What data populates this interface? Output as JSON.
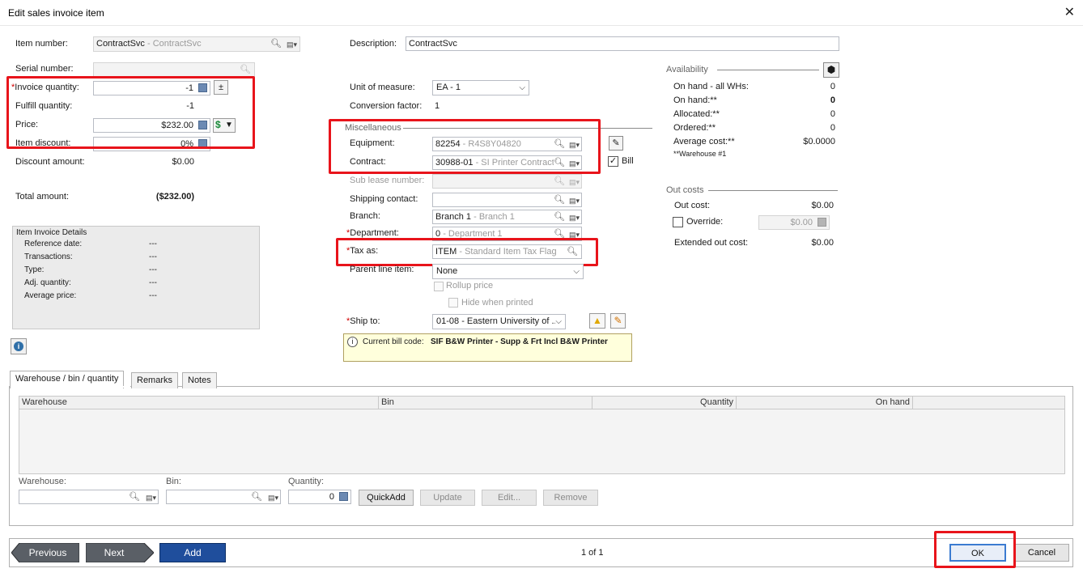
{
  "window": {
    "title": "Edit sales invoice item",
    "close": "✕"
  },
  "item": {
    "item_number_label": "Item number:",
    "item_number_code": "ContractSvc",
    "item_number_desc": "- ContractSvc",
    "serial_label": "Serial number:",
    "invoice_qty_label": "Invoice quantity:",
    "invoice_qty_value": "-1",
    "fulfill_qty_label": "Fulfill quantity:",
    "fulfill_qty_value": "-1",
    "price_label": "Price:",
    "price_value": "$232.00",
    "item_discount_label": "Item discount:",
    "item_discount_value": "0%",
    "discount_amount_label": "Discount amount:",
    "discount_amount_value": "$0.00",
    "total_amount_label": "Total amount:",
    "total_amount_value": "($232.00)",
    "required_mark": "*"
  },
  "invoice_details": {
    "title": "Item Invoice Details",
    "rows": [
      {
        "label": "Reference date:",
        "value": "---"
      },
      {
        "label": "Transactions:",
        "value": "---"
      },
      {
        "label": "Type:",
        "value": "---"
      },
      {
        "label": "Adj. quantity:",
        "value": "---"
      },
      {
        "label": "Average price:",
        "value": "---"
      }
    ]
  },
  "description": {
    "label": "Description:",
    "value": "ContractSvc"
  },
  "uom": {
    "label": "Unit of measure:",
    "value": "EA - 1",
    "conv_label": "Conversion factor:",
    "conv_value": "1"
  },
  "misc": {
    "title": "Miscellaneous",
    "equipment_label": "Equipment:",
    "equipment_code": "82254",
    "equipment_desc": "- R4S8Y04820",
    "contract_label": "Contract:",
    "contract_code": "30988-01",
    "contract_desc": "- SI Printer Contract",
    "bill_label": "Bill",
    "sublease_label": "Sub lease number:",
    "shipping_contact_label": "Shipping contact:",
    "branch_label": "Branch:",
    "branch_code": "Branch 1",
    "branch_desc": "- Branch 1",
    "department_label": "Department:",
    "department_code": "0",
    "department_desc": "- Department 1",
    "tax_label": "Tax as:",
    "tax_code": "ITEM",
    "tax_desc": "- Standard Item Tax Flag",
    "parent_line_label": "Parent line item:",
    "parent_line_value": "None",
    "rollup_label": "Rollup price",
    "hide_label": "Hide when printed",
    "ship_to_label": "Ship to:",
    "ship_to_value": "01-08 - Eastern University of ...",
    "bill_code_label": "Current bill code:",
    "bill_code_value": "SIF B&W Printer - Supp & Frt Incl B&W Printer"
  },
  "availability": {
    "title": "Availability",
    "rows": [
      {
        "label": "On hand - all WHs:",
        "value": "0",
        "bold": false
      },
      {
        "label": "On hand:**",
        "value": "0",
        "bold": true
      },
      {
        "label": "Allocated:**",
        "value": "0",
        "bold": false
      },
      {
        "label": "Ordered:**",
        "value": "0",
        "bold": false
      },
      {
        "label": "Average cost:**",
        "value": "$0.0000",
        "bold": false
      }
    ],
    "footnote": "**Warehouse #1"
  },
  "out_costs": {
    "title": "Out costs",
    "out_cost_label": "Out cost:",
    "out_cost_value": "$0.00",
    "override_label": "Override:",
    "override_value": "$0.00",
    "extended_label": "Extended out cost:",
    "extended_value": "$0.00"
  },
  "tabs": [
    {
      "label": "Warehouse / bin / quantity"
    },
    {
      "label": "Remarks"
    },
    {
      "label": "Notes"
    }
  ],
  "grid": {
    "columns": [
      "Warehouse",
      "Bin",
      "Quantity",
      "On hand"
    ]
  },
  "quickadd": {
    "warehouse_label": "Warehouse:",
    "bin_label": "Bin:",
    "quantity_label": "Quantity:",
    "quantity_value": "0",
    "quickadd_btn": "QuickAdd",
    "update_btn": "Update",
    "edit_btn": "Edit...",
    "remove_btn": "Remove"
  },
  "footer": {
    "previous": "Previous",
    "next": "Next",
    "add": "Add",
    "paging": "1 of 1",
    "ok": "OK",
    "cancel": "Cancel"
  },
  "colors": {
    "highlight_red": "#e8141b",
    "nav_grey": "#5a5f66",
    "add_blue": "#1f4e9c",
    "money_green": "#1a8a3a"
  }
}
